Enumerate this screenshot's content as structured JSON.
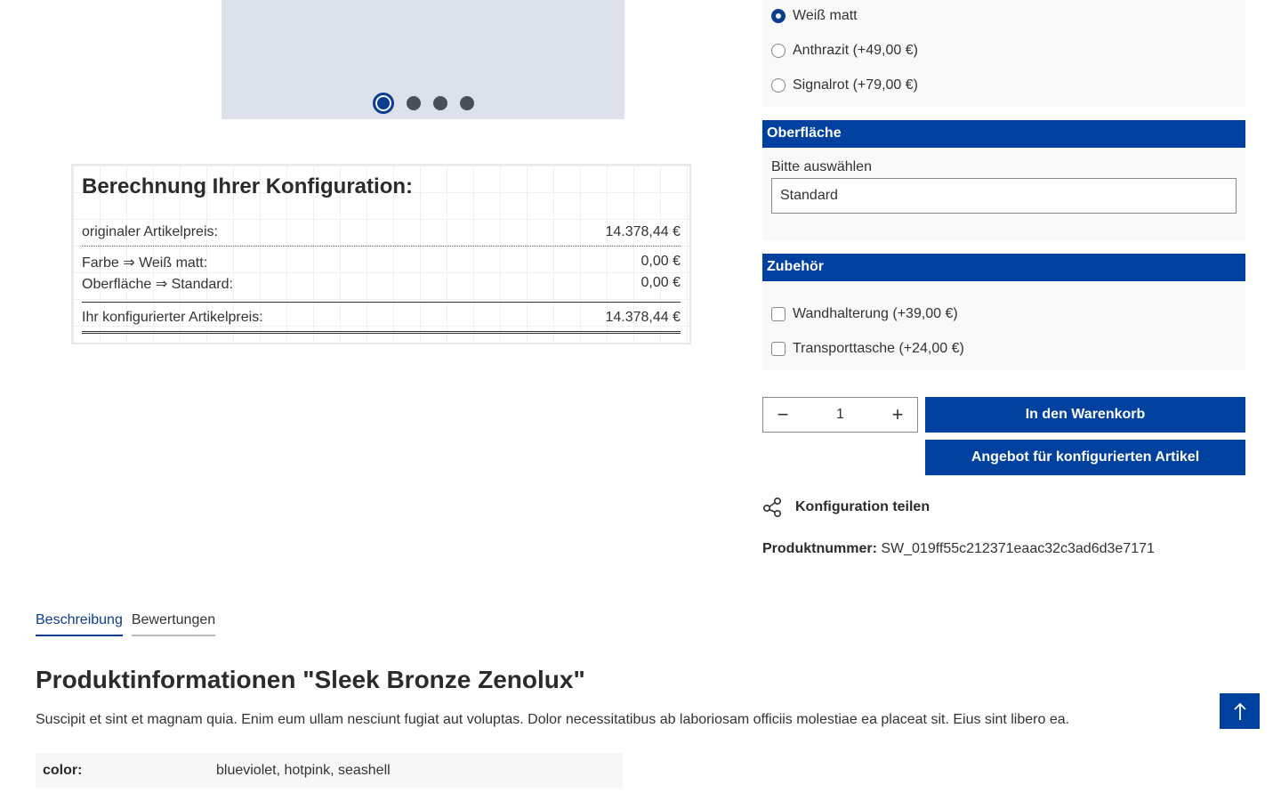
{
  "gallery": {
    "slides": 4,
    "active_slide": 1
  },
  "calculation": {
    "title": "Berechnung Ihrer Konfiguration:",
    "original_label": "originaler Artikelpreis:",
    "original_value": "14.378,44 €",
    "lines": [
      {
        "label": "Farbe ⇒ Weiß matt:",
        "value": "0,00 €"
      },
      {
        "label": "Oberfläche ⇒ Standard:",
        "value": "0,00 €"
      }
    ],
    "total_label": "Ihr konfigurierter Artikelpreis:",
    "total_value": "14.378,44 €"
  },
  "farbe": {
    "options": [
      {
        "label": "Weiß matt",
        "checked": true
      },
      {
        "label": "Anthrazit (+49,00 €)",
        "checked": false
      },
      {
        "label": "Signalrot (+79,00 €)",
        "checked": false
      }
    ]
  },
  "oberflaeche": {
    "title": "Oberfläche",
    "label": "Bitte auswählen",
    "selected": "Standard"
  },
  "zubehoer": {
    "title": "Zubehör",
    "options": [
      {
        "label": "Wandhalterung (+39,00 €)",
        "checked": false
      },
      {
        "label": "Transporttasche (+24,00 €)",
        "checked": false
      }
    ]
  },
  "buy": {
    "quantity": "1",
    "cart_label": "In den Warenkorb",
    "offer_label": "Angebot für konfigurierten Artikel"
  },
  "share": {
    "label": "Konfiguration teilen"
  },
  "product_number": {
    "label": "Produktnummer:",
    "value": "SW_019ff55c212371eaac32c3ad6d3e7171"
  },
  "tabs": [
    {
      "label": "Beschreibung",
      "active": true
    },
    {
      "label": "Bewertungen",
      "active": false
    }
  ],
  "product": {
    "title": "Produktinformationen \"Sleek Bronze Zenolux\"",
    "description": "Suscipit et sint et magnam quia. Enim eum ullam nesciunt fugiat aut voluptas. Dolor necessitatibus ab laboriosam officiis molestiae ea placeat sit. Eius sint libero ea.",
    "properties": [
      {
        "key": "color:",
        "value": "blueviolet, hotpink, seashell"
      }
    ]
  },
  "colors": {
    "primary": "#0041a0",
    "panel": "#f9f9f9",
    "text": "#2b2b2b"
  }
}
